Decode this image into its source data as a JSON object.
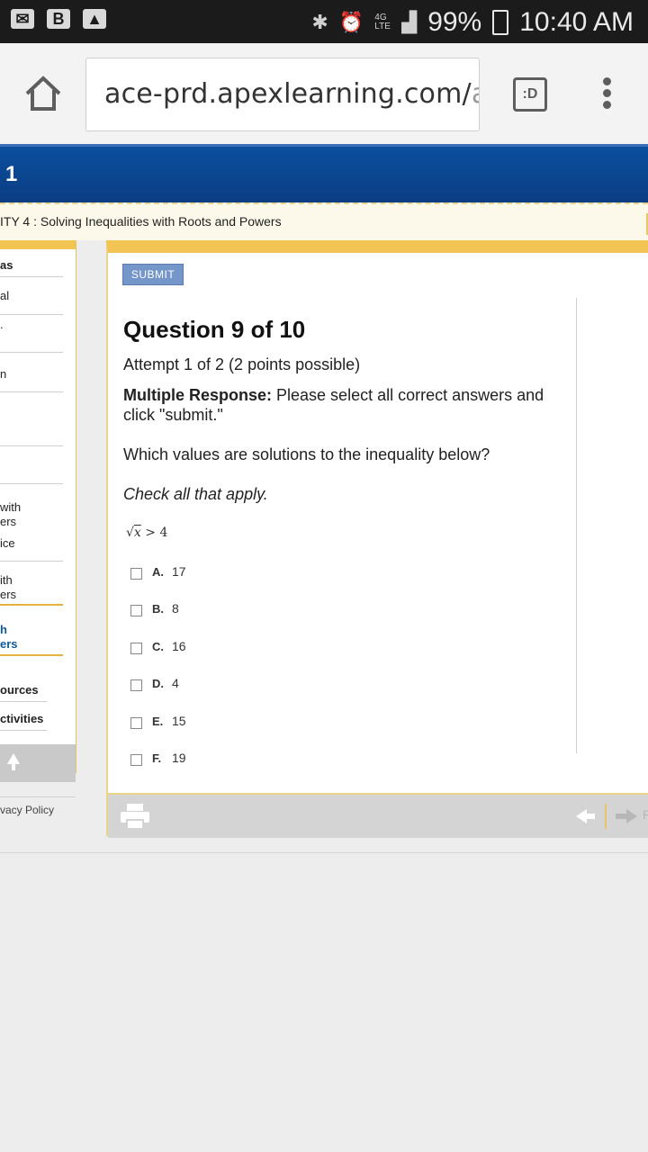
{
  "status_bar": {
    "battery": "99%",
    "time": "10:40 AM",
    "network": "4G LTE",
    "icons": [
      "mail-icon",
      "b-app-icon",
      "gallery-icon",
      "bluetooth-icon",
      "alarm-icon",
      "signal-icon",
      "battery-icon"
    ]
  },
  "browser": {
    "url_main": "ace-prd.apexlearning.com/",
    "url_faded": "app",
    "tab_label": ":D"
  },
  "header": {
    "unit_number": "1",
    "activity_title": "ITY 4 : Solving Inequalities with Roots and Powers"
  },
  "sidebar": {
    "items": [
      {
        "label": "as"
      },
      {
        "label": "al"
      },
      {
        "label": "."
      },
      {
        "label": "n"
      },
      {
        "label": "with"
      },
      {
        "label": "ers"
      },
      {
        "label": "ice"
      },
      {
        "label": "ith"
      },
      {
        "label": "ers"
      },
      {
        "label": "h"
      },
      {
        "label": "ers"
      },
      {
        "label": "ources"
      },
      {
        "label": "ctivities"
      }
    ],
    "privacy": "vacy Policy"
  },
  "question": {
    "submit_label": "SUBMIT",
    "title": "Question 9 of 10",
    "attempt": "Attempt 1 of 2 (2 points possible)",
    "instruction_bold": "Multiple Response:",
    "instruction_rest": " Please select all correct answers and click \"submit.\"",
    "prompt": "Which values are solutions to the inequality below?",
    "check_all": "Check all that apply.",
    "math_radicand": "x",
    "math_rest": " > 4",
    "options": [
      {
        "letter": "A.",
        "value": "17"
      },
      {
        "letter": "B.",
        "value": "8"
      },
      {
        "letter": "C.",
        "value": "16"
      },
      {
        "letter": "D.",
        "value": "4"
      },
      {
        "letter": "E.",
        "value": "15"
      },
      {
        "letter": "F.",
        "value": "19"
      }
    ]
  },
  "footer_nav": {
    "next_label": "P"
  }
}
